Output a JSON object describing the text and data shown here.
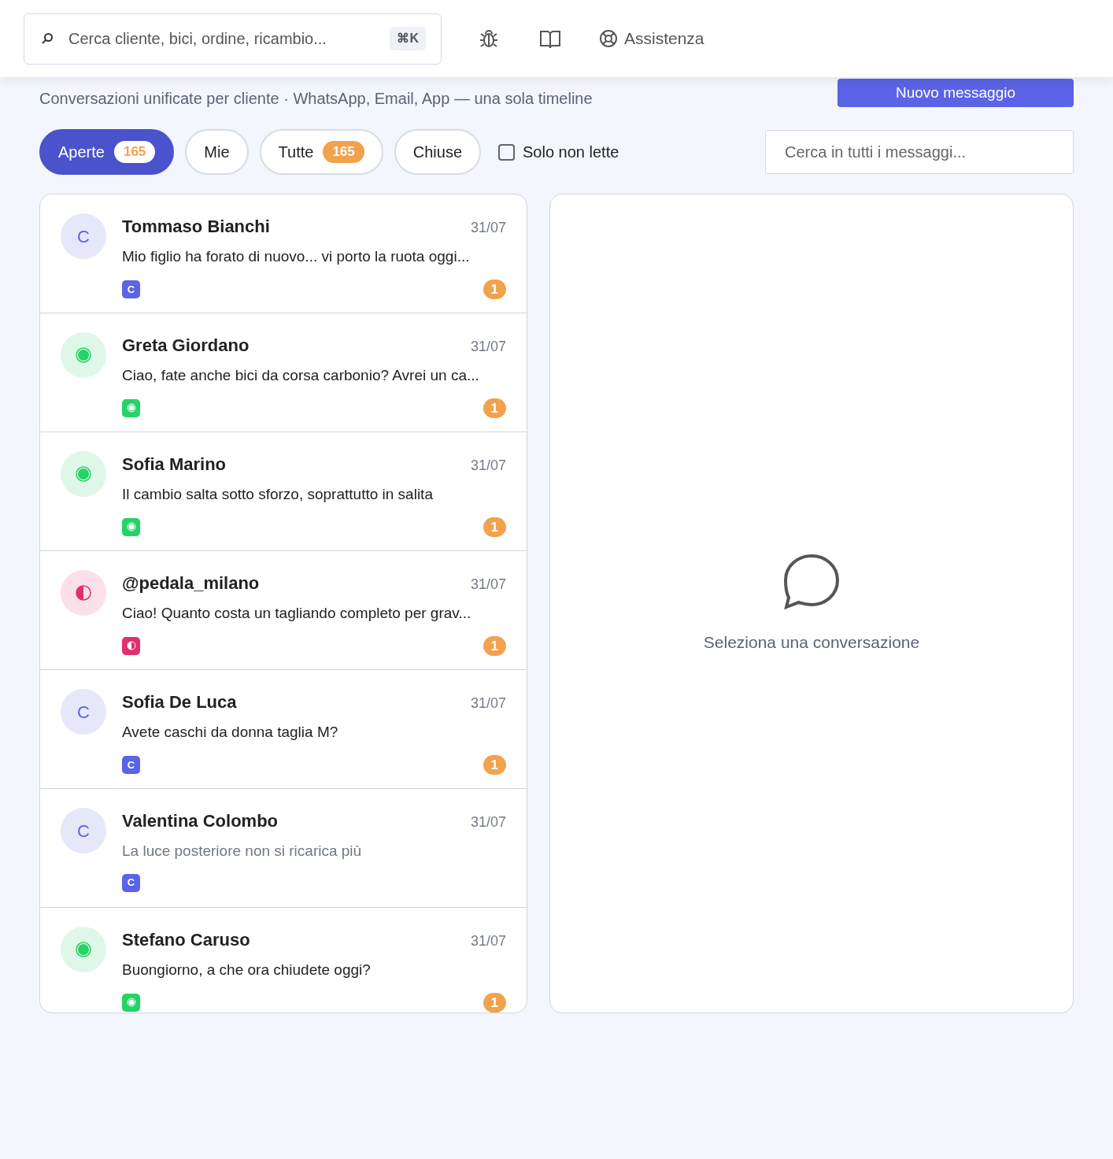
{
  "topbar": {
    "search": {
      "placeholder": "Cerca cliente, bici, ordine, ricambio...",
      "shortcut": "⌘K"
    },
    "help_label": "Assistenza"
  },
  "page": {
    "subtitle": "Conversazioni unificate per cliente · WhatsApp, Email, App — una sola timeline",
    "new_button": "Nuovo messaggio"
  },
  "filters": [
    {
      "label": "Aperte",
      "count": "165",
      "selected": true
    },
    {
      "label": "Mie",
      "selected": false
    },
    {
      "label": "Tutte",
      "count": "165",
      "selected": false
    },
    {
      "label": "Chiuse",
      "selected": false
    }
  ],
  "unread_only": {
    "label": "Solo non lette",
    "checked": false
  },
  "message_search": {
    "placeholder": "Cerca in tutti i messaggi..."
  },
  "conversations": [
    {
      "kind": "letter",
      "avatar_letter": "C",
      "tag_letter": "C",
      "name": "Tommaso Bianchi",
      "date": "31/07",
      "preview": "Mio figlio ha forato di nuovo... vi porto la ruota oggi...",
      "unread": true,
      "unread_count": "1"
    },
    {
      "kind": "whatsapp",
      "name": "Greta Giordano",
      "date": "31/07",
      "preview": "Ciao, fate anche bici da corsa carbonio? Avrei un ca...",
      "unread": true,
      "unread_count": "1"
    },
    {
      "kind": "whatsapp",
      "name": "Sofia Marino",
      "date": "31/07",
      "preview": "Il cambio salta sotto sforzo, soprattutto in salita",
      "unread": true,
      "unread_count": "1"
    },
    {
      "kind": "social",
      "name": "@pedala_milano",
      "date": "31/07",
      "preview": "Ciao! Quanto costa un tagliando completo per grav...",
      "unread": true,
      "unread_count": "1"
    },
    {
      "kind": "letter",
      "avatar_letter": "C",
      "tag_letter": "C",
      "name": "Sofia De Luca",
      "date": "31/07",
      "preview": "Avete caschi da donna taglia M?",
      "unread": true,
      "unread_count": "1"
    },
    {
      "kind": "letter",
      "avatar_letter": "C",
      "tag_letter": "C",
      "name": "Valentina Colombo",
      "date": "31/07",
      "preview": "La luce posteriore non si ricarica più",
      "unread": false
    },
    {
      "kind": "whatsapp",
      "name": "Stefano Caruso",
      "date": "31/07",
      "preview": "Buongiorno, a che ora chiudete oggi?",
      "unread": true,
      "unread_count": "1"
    }
  ],
  "detail": {
    "empty_text": "Seleziona una conversazione"
  }
}
